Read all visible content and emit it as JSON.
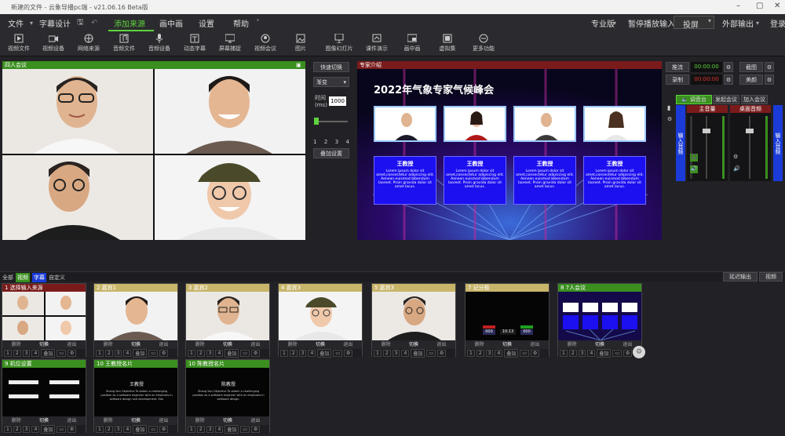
{
  "window": {
    "title": "新建的文件 - 云象导播pc端 - v21.06.16 Beta版"
  },
  "menu": {
    "file": "文件",
    "subtitle_design": "字幕设计",
    "add_source": "添加来源",
    "pip": "画中画",
    "settings": "设置",
    "help": "帮助",
    "edition": "专业版",
    "pause_input": "暂停播放输入",
    "stream": "投屏",
    "external_output": "外部输出",
    "login": "登录"
  },
  "toolbar": {
    "items": [
      "视频文件",
      "视频设备",
      "网络来源",
      "音频文件",
      "音频设备",
      "动态字幕",
      "屏幕捕捉",
      "视频会议",
      "图片",
      "图像幻灯片",
      "课件演示",
      "画中画",
      "虚拟集",
      "更多功能"
    ]
  },
  "preview": {
    "title": "四人会议"
  },
  "program": {
    "title": "专家介绍",
    "headline": "2022年气象专家气候峰会",
    "card_title": "王教授",
    "card_body": "Lorem ipsum dolor sit amet,consectetur adipiscing elit. Aenean euismod bibendum laoreet. Proin gravida dolor sit amet lacus."
  },
  "transition": {
    "quick_switch": "快速切换",
    "mode": "渐变",
    "time_label": "时间 (ms)",
    "time_value": "1000",
    "pages": [
      "1",
      "2",
      "3",
      "4"
    ],
    "overlay_settings": "叠加设置"
  },
  "recording": {
    "stream_label": "推流",
    "record_label": "录制",
    "stream_time": "00:00:00",
    "record_time": "00:00:00",
    "screenshot": "截图",
    "beauty": "美颜"
  },
  "audio": {
    "tabs": [
      "调音台",
      "发起会议",
      "加入会议"
    ],
    "master": "主音量",
    "desktop": "桌面音频",
    "input_left": "输入音频",
    "input_right": "输入音频"
  },
  "filters": {
    "tabs": [
      "全部",
      "视频",
      "字幕",
      "自定义"
    ],
    "delay_output": "延迟输出",
    "sort": "视频"
  },
  "sources": [
    {
      "title": "1 选择输入来源"
    },
    {
      "title": "2 嘉宾1"
    },
    {
      "title": "3 嘉宾2"
    },
    {
      "title": "4 嘉宾3"
    },
    {
      "title": "5 嘉宾3"
    },
    {
      "title": "7 记分板"
    },
    {
      "title": "8 7人会议"
    },
    {
      "title": "9 机位设置"
    },
    {
      "title": "10 王教授名片"
    },
    {
      "title": "10 陈教授名片"
    }
  ],
  "card_controls": {
    "delete": "删除",
    "switch": "切换",
    "exit": "退出",
    "overlay": "叠加",
    "nums": [
      "1",
      "2",
      "3",
      "4"
    ]
  },
  "scoreboard": {
    "left": "000",
    "mid": "10:13",
    "right": "000"
  },
  "name_cards": {
    "c1_name": "王教授",
    "c2_name": "陈教授",
    "c1_text": "Zhang San Objective To obtain a challenging position as a software engineer with an emphasis in software design and development. Edu",
    "c2_text": "Zhang San Objective To obtain a challenging position as a software engineer with an emphasis in software design."
  },
  "colors": {
    "accent_green": "#3a8f1f",
    "program_red": "#7a1b1b",
    "gold": "#c8b56a",
    "blue": "#1c0ff0"
  }
}
